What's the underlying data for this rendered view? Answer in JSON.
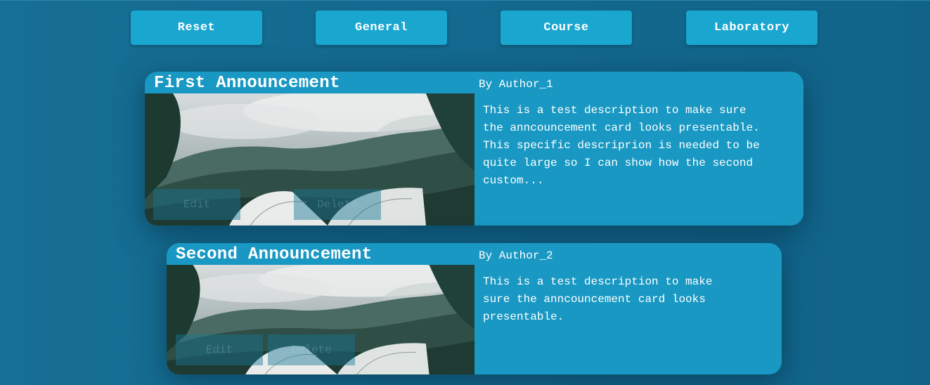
{
  "filters": [
    {
      "label": "Reset"
    },
    {
      "label": "General"
    },
    {
      "label": "Course"
    },
    {
      "label": "Laboratory"
    }
  ],
  "announcements": [
    {
      "title": "First Announcement",
      "author": "By Author_1",
      "description_lines": [
        "This is a test description to make sure",
        "the anncouncement card looks presentable.",
        "This specific descriprion is needed to be",
        "quite large so I can show how the second",
        "custom..."
      ],
      "edit_label": "Edit",
      "delete_label": "Delete"
    },
    {
      "title": "Second Announcement",
      "author": "By Author_2",
      "description_lines": [
        "This is a test description to make",
        "sure the anncouncement card looks",
        "presentable."
      ],
      "edit_label": "Edit",
      "delete_label": "Delete"
    }
  ],
  "colors": {
    "background": "#13698f",
    "button": "#19a6cf",
    "card": "#1898c3",
    "text": "#ffffff"
  }
}
